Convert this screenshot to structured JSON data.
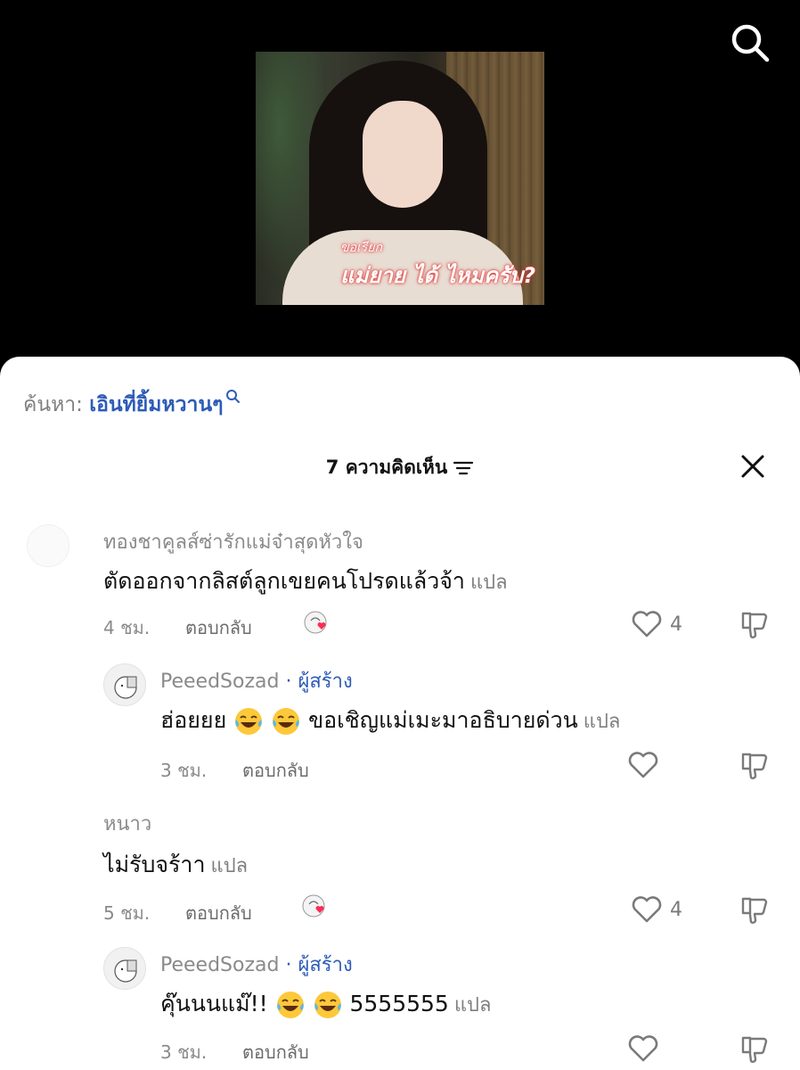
{
  "video": {
    "caption_small": "ขอเรียก",
    "caption_big": "แม่ยาย ได้ ไหมครับ?",
    "search_icon": "search-icon"
  },
  "search_hint": {
    "label": "ค้นหา:",
    "query": "เอินที่ยิ้มหวานๆ"
  },
  "header": {
    "title": "7 ความคิดเห็น",
    "sort_icon": "sort-icon",
    "close_icon": "close-icon"
  },
  "comments": [
    {
      "username": "ทองชาคูลส์ซ่ารักแม่จ๋าสุดหัวใจ",
      "text": "ตัดออกจากลิสต์ลูกเขยคนโปรดแล้วจ้า",
      "translate": "แปล",
      "time": "4 ชม.",
      "reply": "ตอบกลับ",
      "likes": "4",
      "creator_liked": true
    },
    {
      "username": "PeeedSozad",
      "creator_tag": "· ผู้สร้าง",
      "text_before": "ฮ่อยยย",
      "text_after": "ขอเชิญแม่เมะมาอธิบายด่วน",
      "translate": "แปล",
      "time": "3 ชม.",
      "reply": "ตอบกลับ",
      "likes": ""
    },
    {
      "username": "หนาว",
      "text": "ไม่รับจร้าา",
      "translate": "แปล",
      "time": "5 ชม.",
      "reply": "ตอบกลับ",
      "likes": "4",
      "creator_liked": true
    },
    {
      "username": "PeeedSozad",
      "creator_tag": "· ผู้สร้าง",
      "text_before": "คุ๊นนนแม๊!!",
      "text_after": "5555555",
      "translate": "แปล",
      "time": "3 ชม.",
      "reply": "ตอบกลับ",
      "likes": ""
    }
  ],
  "colors": {
    "accent": "#2e5bb8",
    "muted": "#8a8a8a",
    "heart_red": "#fe2c55"
  }
}
